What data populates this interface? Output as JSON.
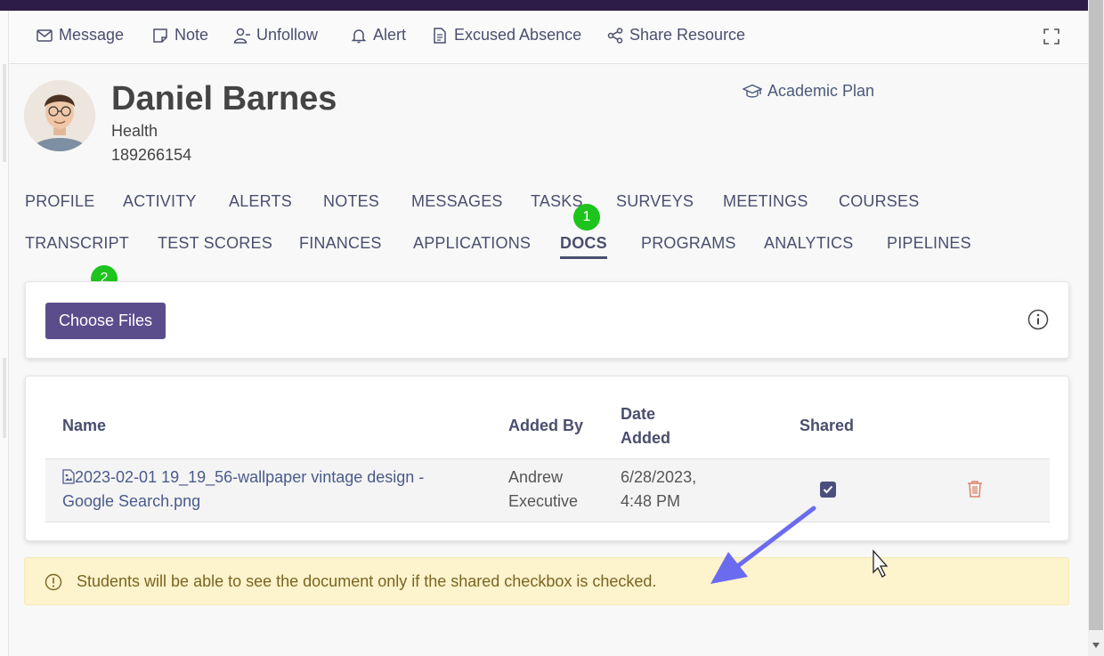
{
  "actions": [
    {
      "label": "Message",
      "icon": "envelope-icon"
    },
    {
      "label": "Note",
      "icon": "note-icon"
    },
    {
      "label": "Unfollow",
      "icon": "user-minus-icon"
    },
    {
      "label": "Alert",
      "icon": "bell-icon"
    },
    {
      "label": "Excused Absence",
      "icon": "document-icon"
    },
    {
      "label": "Share Resource",
      "icon": "share-icon"
    }
  ],
  "student": {
    "name": "Daniel Barnes",
    "program": "Health",
    "id": "189266154"
  },
  "academic_plan": {
    "label": "Academic Plan",
    "icon": "graduation-cap-icon"
  },
  "tabs_row1": [
    "PROFILE",
    "ACTIVITY",
    "ALERTS",
    "NOTES",
    "MESSAGES",
    "TASKS",
    "SURVEYS",
    "MEETINGS",
    "COURSES"
  ],
  "tabs_row2": [
    "TRANSCRIPT",
    "TEST SCORES",
    "FINANCES",
    "APPLICATIONS",
    "DOCS",
    "PROGRAMS",
    "ANALYTICS",
    "PIPELINES"
  ],
  "active_tab": "DOCS",
  "badges": [
    "1",
    "2"
  ],
  "upload": {
    "button_label": "Choose Files",
    "info_icon": "info-circle-icon"
  },
  "table": {
    "headers": {
      "name": "Name",
      "added_by": "Added By",
      "date_added_1": "Date",
      "date_added_2": "Added",
      "shared": "Shared"
    },
    "rows": [
      {
        "name_1": "2023-02-01 19_19_56-wallpaper vintage design -",
        "name_2": "Google Search.png",
        "added_by_1": "Andrew",
        "added_by_2": "Executive",
        "date_1": "6/28/2023,",
        "date_2": "4:48 PM",
        "shared": true
      }
    ]
  },
  "notice": {
    "text": "Students will be able to see the document only if the shared checkbox is checked.",
    "icon": "exclamation-circle-icon"
  },
  "colors": {
    "primary": "#5b4d8c",
    "topbar": "#2b1d47",
    "badge": "#1dc41d",
    "notice_bg": "#fdf3cd",
    "arrow": "#6b6bf0",
    "trash": "#d9856a"
  }
}
